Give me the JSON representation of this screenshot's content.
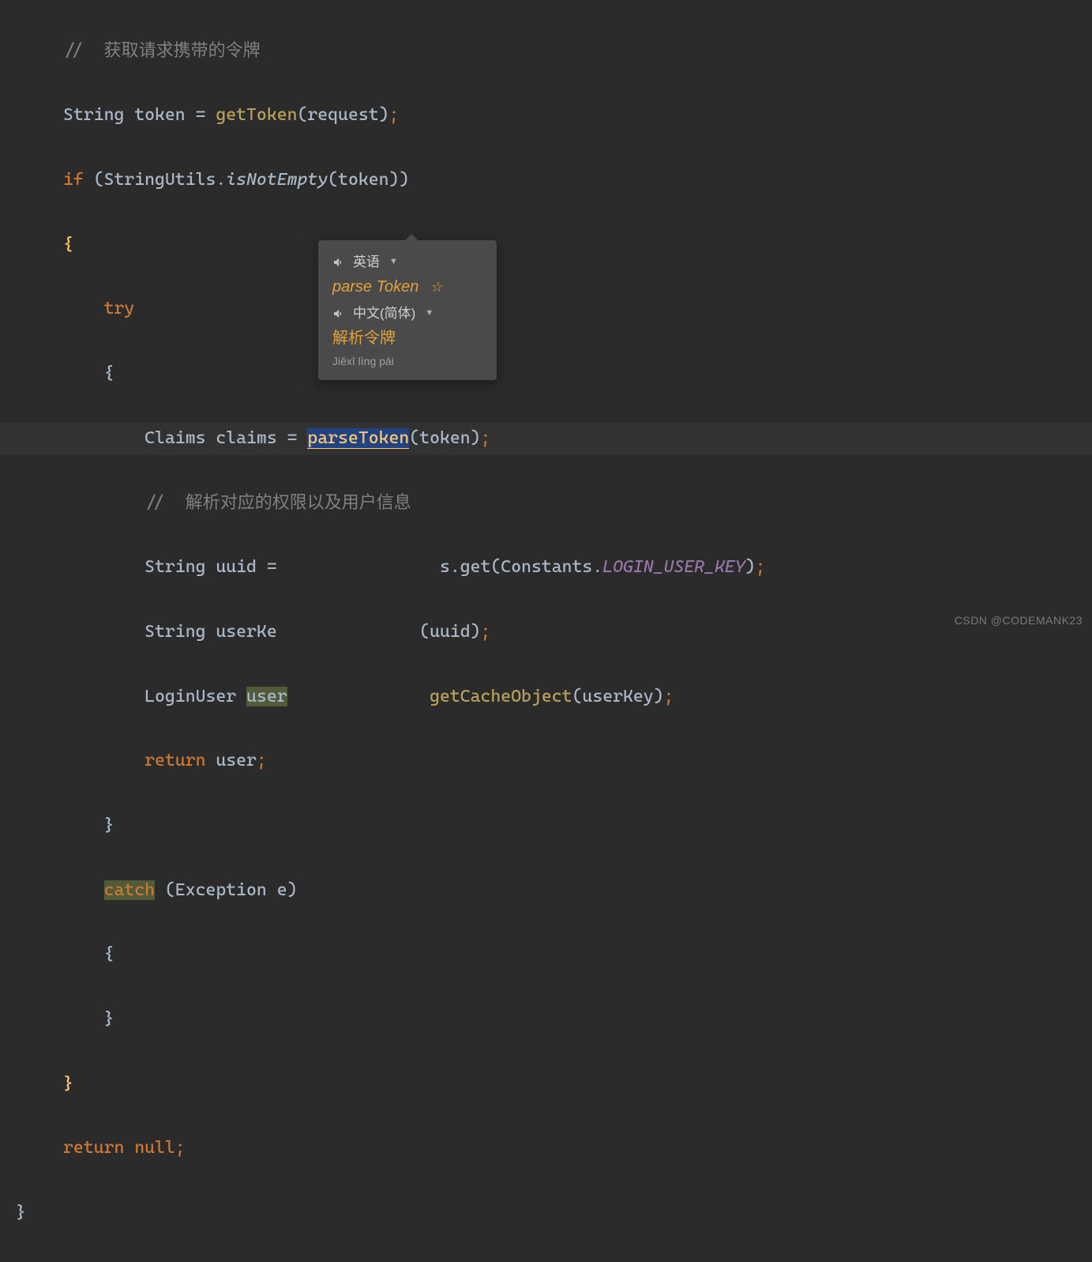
{
  "code": {
    "comment1": "//  获取请求携带的令牌",
    "l2_type": "String",
    "l2_var": "token",
    "l2_eq": " = ",
    "l2_call": "getToken",
    "l2_paren_o": "(",
    "l2_arg": "request",
    "l2_paren_c": ")",
    "l2_semi": ";",
    "l3_if": "if ",
    "l3_po": "(",
    "l3_cls": "StringUtils",
    "l3_dot": ".",
    "l3_m": "isNotEmpty",
    "l3_po2": "(",
    "l3_arg": "token",
    "l3_pc2": ")",
    "l3_pc": ")",
    "brace_o": "{",
    "brace_c": "}",
    "try": "try",
    "l7_cls": "Claims",
    "l7_var": " claims = ",
    "l7_m": "parseToken",
    "l7_po": "(",
    "l7_arg": "token",
    "l7_pc": ")",
    "l7_semi": ";",
    "comment2": "//  解析对应的权限以及用户信息",
    "l9_type": "String",
    "l9_var": " uuid = ",
    "l9_tail_a": "s.get",
    "l9_po": "(",
    "l9_cls": "Constants",
    "l9_dot": ".",
    "l9_const": "LOGIN_USER_KEY",
    "l9_pc": ")",
    "l9_semi": ";",
    "l10_type": "String",
    "l10_var": " userKe",
    "l10_po": "(",
    "l10_arg": "uuid",
    "l10_pc": ")",
    "l10_semi": ";",
    "l11_cls": "LoginUser ",
    "l11_var": "user",
    "l11_tail": "getCacheObject",
    "l11_po": "(",
    "l11_arg": "userKey",
    "l11_pc": ")",
    "l11_semi": ";",
    "l12_ret": "return",
    "l12_var": " user",
    "l12_semi": ";",
    "catch": "catch",
    "l14_po": " (",
    "l14_cls": "Exception",
    "l14_var": " e",
    "l14_pc": ")",
    "l18_ret": "return ",
    "l18_null": "null",
    "l18_semi": ";"
  },
  "tooltip": {
    "lang1": "英语",
    "main": "parse Token",
    "lang2": "中文(简体)",
    "translation": "解析令牌",
    "pinyin": "Jiěxī lìng pái"
  },
  "watermark": "CSDN @CODEMANK23"
}
